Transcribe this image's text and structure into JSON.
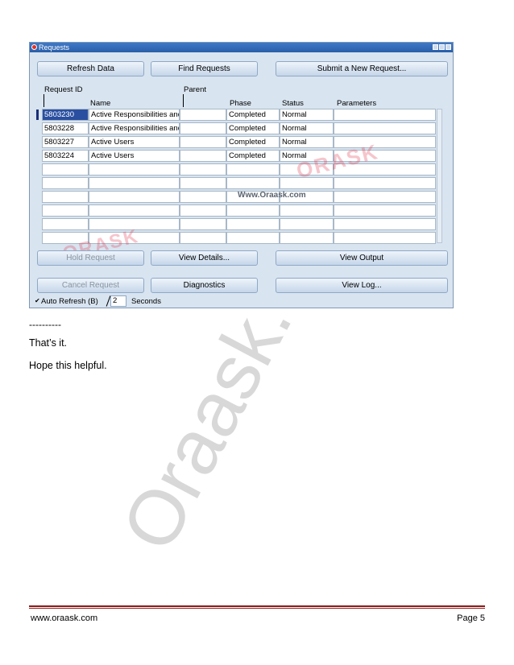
{
  "window": {
    "title": "Requests",
    "buttons": {
      "refresh": "Refresh Data",
      "find": "Find Requests",
      "submit": "Submit a New Request...",
      "hold": "Hold Request",
      "view_details": "View Details...",
      "view_output": "View Output",
      "cancel": "Cancel Request",
      "diagnostics": "Diagnostics",
      "view_log": "View Log..."
    },
    "columns": {
      "request_id": "Request ID",
      "parent": "Parent",
      "name": "Name",
      "phase": "Phase",
      "status": "Status",
      "parameters": "Parameters"
    },
    "rows": [
      {
        "id": "5803230",
        "name": "Active Responsibilities and",
        "parent": "",
        "phase": "Completed",
        "status": "Normal",
        "parameters": ""
      },
      {
        "id": "5803228",
        "name": "Active Responsibilities and",
        "parent": "",
        "phase": "Completed",
        "status": "Normal",
        "parameters": ""
      },
      {
        "id": "5803227",
        "name": "Active Users",
        "parent": "",
        "phase": "Completed",
        "status": "Normal",
        "parameters": ""
      },
      {
        "id": "5803224",
        "name": "Active Users",
        "parent": "",
        "phase": "Completed",
        "status": "Normal",
        "parameters": ""
      }
    ],
    "empty_row_count": 6,
    "auto_refresh": {
      "label": "Auto Refresh (B)",
      "checked": true,
      "value": "2",
      "unit": "Seconds"
    },
    "watermark_url": "Www.Oraask.com",
    "watermark_logo": "ORASK"
  },
  "doc": {
    "divider": "----------",
    "line1": "That’s it.",
    "line2": "Hope this helpful.",
    "big_watermark": "Oraask.",
    "footer_left": "www.oraask.com",
    "footer_right": "Page 5"
  },
  "colors": {
    "title_bar": "#2a5ea8",
    "panel": "#d8e4f0",
    "selection": "#2a4fa0",
    "watermark_red": "#e0334a",
    "footer_rule": "#8b1a1a"
  }
}
